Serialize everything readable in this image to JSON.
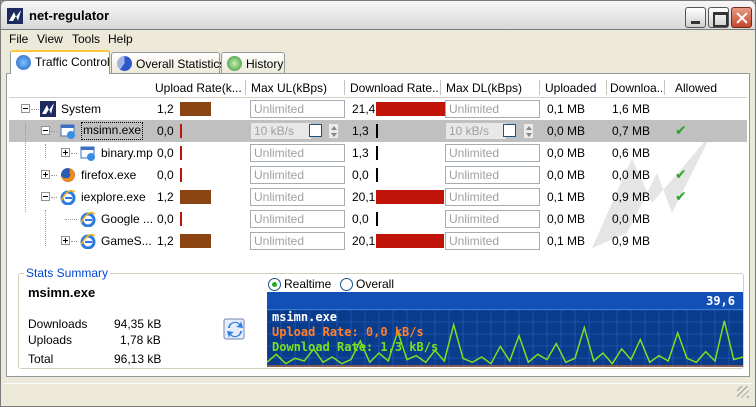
{
  "window": {
    "title": "net-regulator"
  },
  "menu": [
    "File",
    "View",
    "Tools",
    "Help"
  ],
  "tabs": [
    {
      "label": "Traffic Control",
      "active": true
    },
    {
      "label": "Overall Statistics",
      "active": false
    },
    {
      "label": "History",
      "active": false
    }
  ],
  "columns": [
    "Upload Rate(k...",
    "Max UL(kBps)",
    "Download Rate...",
    "Max DL(kBps)",
    "Uploaded",
    "Downloa...",
    "Allowed"
  ],
  "rows": [
    {
      "name": "System",
      "ul_rate": "1,2",
      "ul_level": 0.85,
      "max_ul": "Unlimited",
      "dl_rate": "21,4",
      "dl_level": 1.0,
      "max_dl": "Unlimited",
      "uploaded": "0,1 MB",
      "downloaded": "1,6 MB",
      "allowed": false
    },
    {
      "name": "msimn.exe",
      "ul_rate": "0,0",
      "ul_level": 0.02,
      "max_ul": "10 kB/s",
      "dl_rate": "1,3",
      "dl_level": 0.03,
      "max_dl": "10 kB/s",
      "uploaded": "0,0 MB",
      "downloaded": "0,7 MB",
      "allowed": true
    },
    {
      "name": "binary.mp",
      "ul_rate": "0,0",
      "ul_level": 0.02,
      "max_ul": "Unlimited",
      "dl_rate": "1,3",
      "dl_level": 0.03,
      "max_dl": "Unlimited",
      "uploaded": "0,0 MB",
      "downloaded": "0,6 MB",
      "allowed": false
    },
    {
      "name": "firefox.exe",
      "ul_rate": "0,0",
      "ul_level": 0.02,
      "max_ul": "Unlimited",
      "dl_rate": "0,0",
      "dl_level": 0.02,
      "max_dl": "Unlimited",
      "uploaded": "0,0 MB",
      "downloaded": "0,0 MB",
      "allowed": true
    },
    {
      "name": "iexplore.exe",
      "ul_rate": "1,2",
      "ul_level": 0.85,
      "max_ul": "Unlimited",
      "dl_rate": "20,1",
      "dl_level": 0.95,
      "max_dl": "Unlimited",
      "uploaded": "0,1 MB",
      "downloaded": "0,9 MB",
      "allowed": true
    },
    {
      "name": "Google ...",
      "ul_rate": "0,0",
      "ul_level": 0.02,
      "max_ul": "Unlimited",
      "dl_rate": "0,0",
      "dl_level": 0.02,
      "max_dl": "Unlimited",
      "uploaded": "0,0 MB",
      "downloaded": "0,0 MB",
      "allowed": false
    },
    {
      "name": "GameS...",
      "ul_rate": "1,2",
      "ul_level": 0.85,
      "max_ul": "Unlimited",
      "dl_rate": "20,1",
      "dl_level": 0.95,
      "max_dl": "Unlimited",
      "uploaded": "0,1 MB",
      "downloaded": "0,9 MB",
      "allowed": false
    }
  ],
  "stats": {
    "legend": "Stats Summary",
    "process": "msimn.exe",
    "downloads_label": "Downloads",
    "downloads_value": "94,35 kB",
    "uploads_label": "Uploads",
    "uploads_value": "1,78 kB",
    "total_label": "Total",
    "total_value": "96,13 kB",
    "radio_realtime": "Realtime",
    "radio_overall": "Overall",
    "graph_max": "39,6",
    "graph_title": "msimn.exe",
    "graph_upload": "Upload Rate:    0,0 kB/s",
    "graph_download": "Download Rate: 1,3 kB/s",
    "download_series": [
      2,
      8,
      1,
      5,
      3,
      12,
      2,
      6,
      1,
      4,
      18,
      2,
      9,
      3,
      25,
      4,
      7,
      2,
      11,
      3,
      30,
      5,
      2,
      6,
      1,
      14,
      3,
      22,
      2,
      8,
      4,
      16,
      2,
      5,
      28,
      3,
      9,
      1,
      12,
      4,
      19,
      2,
      7,
      3,
      24,
      5,
      2,
      10,
      3,
      33,
      4,
      6
    ],
    "graph_colors": {
      "bg": "#0a3c8c",
      "grid": "#2a62c4",
      "download": "#7be01d",
      "upload": "#ff7f2a"
    }
  },
  "colors": {
    "bar": "#8b4513",
    "dl_bar": "#c0140a",
    "allowed": "#2aa52a"
  }
}
